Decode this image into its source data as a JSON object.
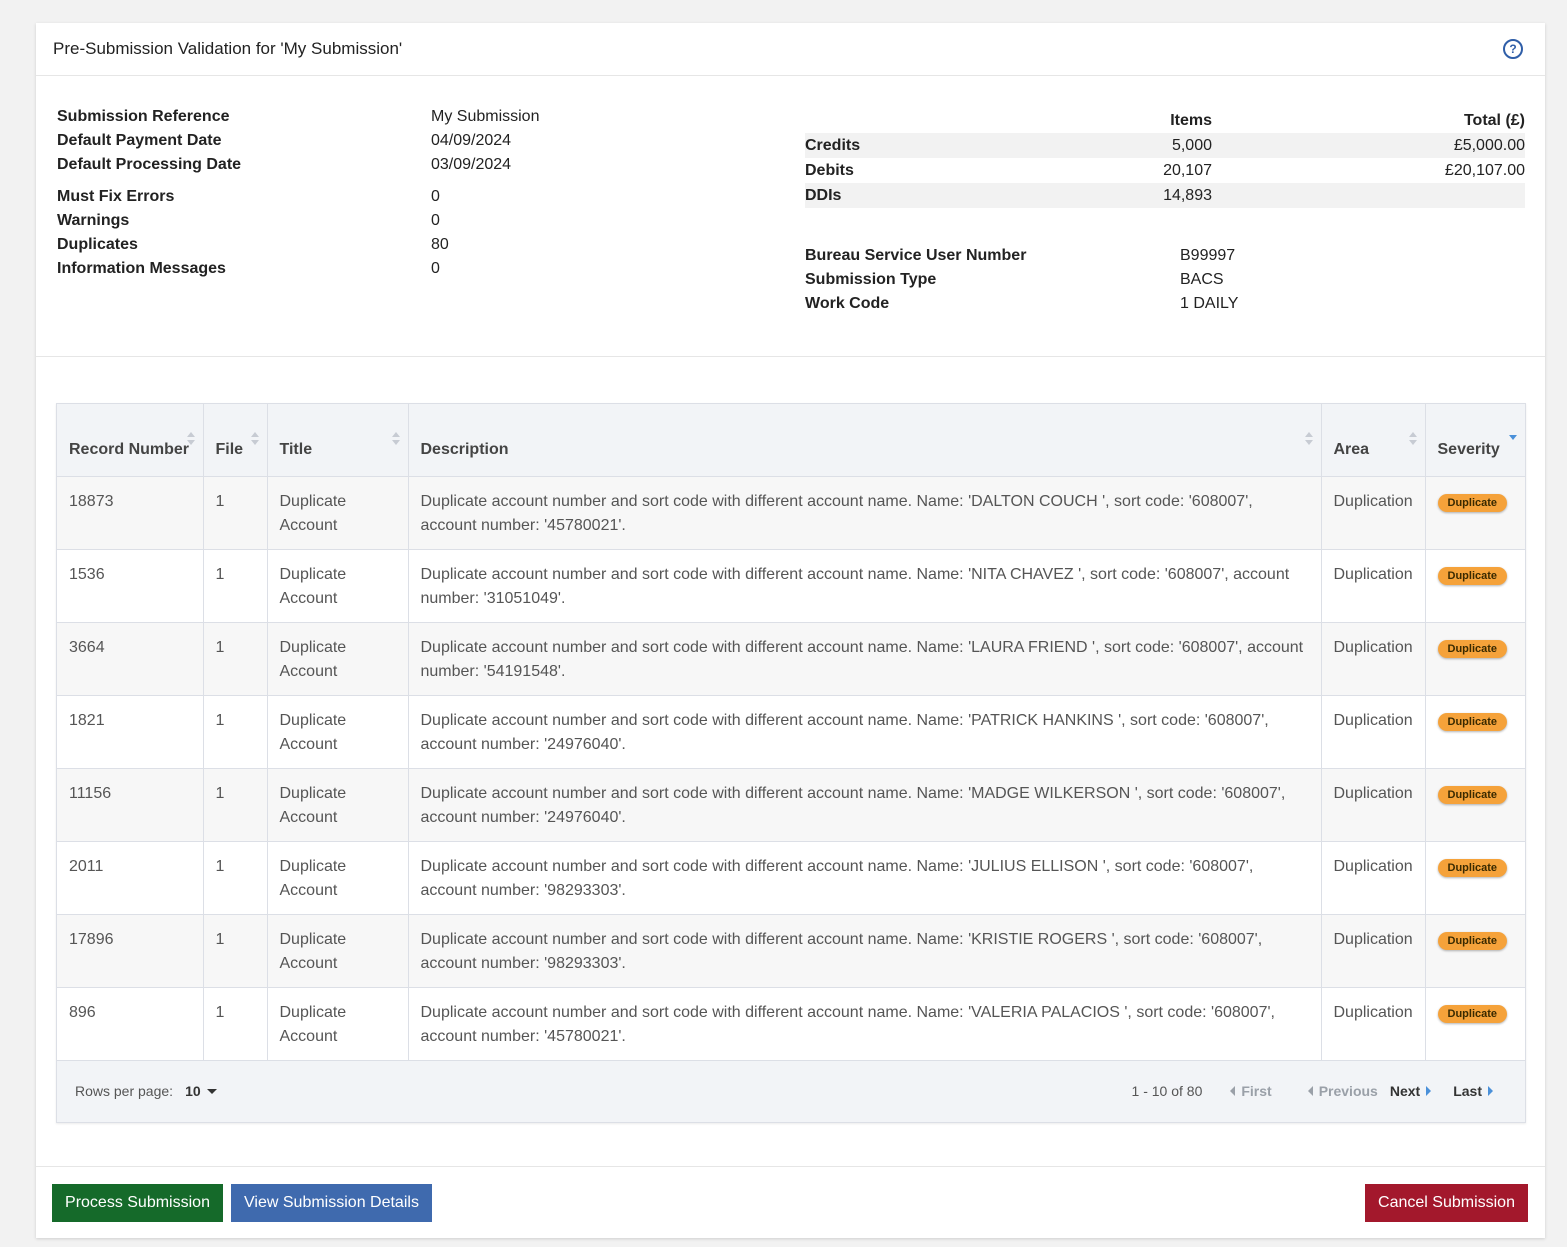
{
  "header": {
    "title": "Pre-Submission Validation for 'My Submission'",
    "help_icon": "?"
  },
  "summary": {
    "fields": [
      {
        "label": "Submission Reference",
        "value": "My Submission"
      },
      {
        "label": "Default Payment Date",
        "value": "04/09/2024"
      },
      {
        "label": "Default Processing Date",
        "value": "03/09/2024"
      },
      {
        "label": "Must Fix Errors",
        "value": "0"
      },
      {
        "label": "Warnings",
        "value": "0"
      },
      {
        "label": "Duplicates",
        "value": "80"
      },
      {
        "label": "Information Messages",
        "value": "0"
      }
    ],
    "totals": {
      "items_header": "Items",
      "total_header": "Total (£)",
      "rows": [
        {
          "label": "Credits",
          "items": "5,000",
          "total": "£5,000.00"
        },
        {
          "label": "Debits",
          "items": "20,107",
          "total": "£20,107.00"
        },
        {
          "label": "DDIs",
          "items": "14,893",
          "total": ""
        }
      ]
    },
    "bureau": [
      {
        "label": "Bureau Service User Number",
        "value": "B99997"
      },
      {
        "label": "Submission Type",
        "value": "BACS"
      },
      {
        "label": "Work Code",
        "value": "1 DAILY"
      }
    ]
  },
  "table": {
    "columns": [
      "Record Number",
      "File",
      "Title",
      "Description",
      "Area",
      "Severity"
    ],
    "rows": [
      {
        "record": "18873",
        "file": "1",
        "title": "Duplicate Account",
        "description": "Duplicate account number and sort code with different account name. Name: 'DALTON COUCH ', sort code: '608007', account number: '45780021'.",
        "area": "Duplication",
        "severity": "Duplicate"
      },
      {
        "record": "1536",
        "file": "1",
        "title": "Duplicate Account",
        "description": "Duplicate account number and sort code with different account name. Name: 'NITA CHAVEZ ', sort code: '608007', account number: '31051049'.",
        "area": "Duplication",
        "severity": "Duplicate"
      },
      {
        "record": "3664",
        "file": "1",
        "title": "Duplicate Account",
        "description": "Duplicate account number and sort code with different account name. Name: 'LAURA FRIEND ', sort code: '608007', account number: '54191548'.",
        "area": "Duplication",
        "severity": "Duplicate"
      },
      {
        "record": "1821",
        "file": "1",
        "title": "Duplicate Account",
        "description": "Duplicate account number and sort code with different account name. Name: 'PATRICK HANKINS ', sort code: '608007', account number: '24976040'.",
        "area": "Duplication",
        "severity": "Duplicate"
      },
      {
        "record": "11156",
        "file": "1",
        "title": "Duplicate Account",
        "description": "Duplicate account number and sort code with different account name. Name: 'MADGE WILKERSON ', sort code: '608007', account number: '24976040'.",
        "area": "Duplication",
        "severity": "Duplicate"
      },
      {
        "record": "2011",
        "file": "1",
        "title": "Duplicate Account",
        "description": "Duplicate account number and sort code with different account name. Name: 'JULIUS ELLISON ', sort code: '608007', account number: '98293303'.",
        "area": "Duplication",
        "severity": "Duplicate"
      },
      {
        "record": "17896",
        "file": "1",
        "title": "Duplicate Account",
        "description": "Duplicate account number and sort code with different account name. Name: 'KRISTIE ROGERS ', sort code: '608007', account number: '98293303'.",
        "area": "Duplication",
        "severity": "Duplicate"
      },
      {
        "record": "896",
        "file": "1",
        "title": "Duplicate Account",
        "description": "Duplicate account number and sort code with different account name. Name: 'VALERIA PALACIOS ', sort code: '608007', account number: '45780021'.",
        "area": "Duplication",
        "severity": "Duplicate"
      }
    ],
    "footer": {
      "rows_per_page_label": "Rows per page:",
      "rows_per_page_value": "10",
      "range": "1 - 10 of 80",
      "first": "First",
      "previous": "Previous",
      "next": "Next",
      "last": "Last"
    }
  },
  "actions": {
    "process": "Process Submission",
    "view": "View Submission Details",
    "cancel": "Cancel Submission"
  },
  "colors": {
    "process": "#156a2a",
    "view": "#3f6aae",
    "cancel": "#a3182c",
    "badge": "#f5a23a"
  }
}
